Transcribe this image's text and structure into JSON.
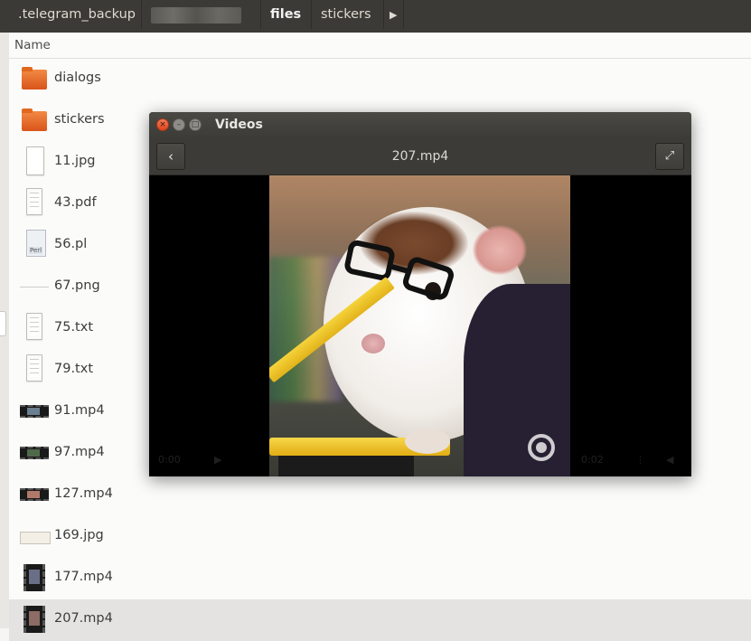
{
  "pathbar": {
    "crumbs": [
      ".telegram_backup",
      "",
      "files",
      "stickers"
    ],
    "next_arrow": "▶"
  },
  "list": {
    "column_name": "Name",
    "files": [
      {
        "name": "dialogs",
        "icon": "folder-icon"
      },
      {
        "name": "stickers",
        "icon": "folder-icon"
      },
      {
        "name": "11.jpg",
        "icon": "image-file-icon"
      },
      {
        "name": "43.pdf",
        "icon": "pdf-file-icon"
      },
      {
        "name": "56.pl",
        "icon": "perl-file-icon"
      },
      {
        "name": "67.png",
        "icon": "image-file-icon"
      },
      {
        "name": "75.txt",
        "icon": "text-file-icon"
      },
      {
        "name": "79.txt",
        "icon": "text-file-icon"
      },
      {
        "name": "91.mp4",
        "icon": "video-thumbnail-icon"
      },
      {
        "name": "97.mp4",
        "icon": "video-thumbnail-icon"
      },
      {
        "name": "127.mp4",
        "icon": "video-thumbnail-icon"
      },
      {
        "name": "169.jpg",
        "icon": "image-thumbnail-icon"
      },
      {
        "name": "177.mp4",
        "icon": "video-thumbnail-icon"
      },
      {
        "name": "207.mp4",
        "icon": "video-thumbnail-icon",
        "selected": true
      }
    ]
  },
  "video_window": {
    "title": "Videos",
    "file_title": "207.mp4",
    "close_glyph": "×",
    "min_glyph": "–",
    "max_glyph": "□",
    "back_glyph": "‹",
    "fullscreen_glyph": "⤢",
    "time_start": "0:00",
    "time_end": "0:02"
  },
  "colors": {
    "pathbar_bg": "#3b3a36",
    "folder_orange": "#e0691f",
    "selected_row": "#e4e3e1",
    "close_button": "#e0431d"
  }
}
